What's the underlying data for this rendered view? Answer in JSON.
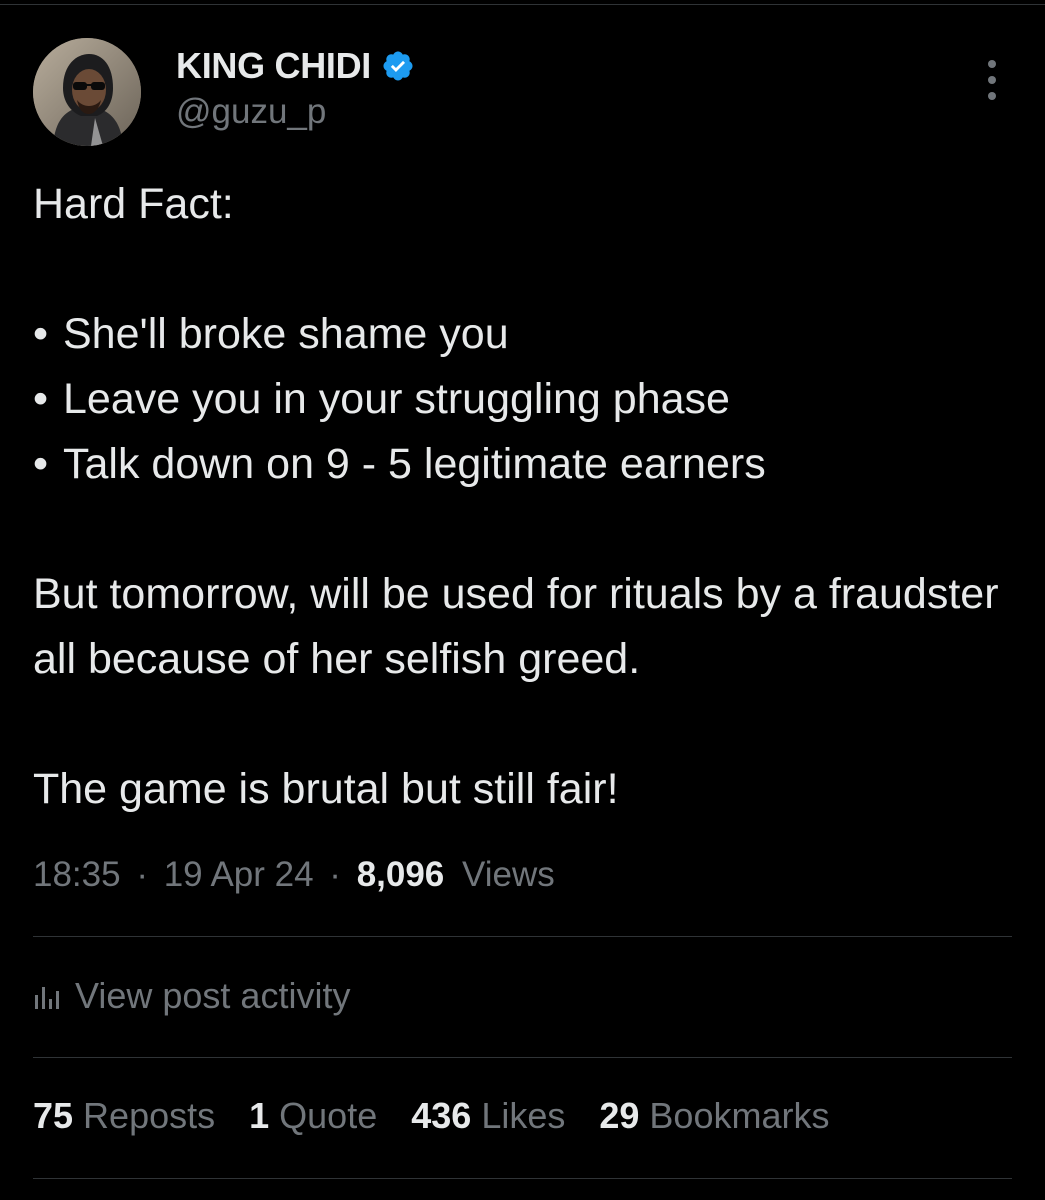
{
  "author": {
    "display_name": "KING CHIDI",
    "handle": "@guzu_p",
    "verified_icon": "verified-badge-icon",
    "accent_color": "#1d9bf0"
  },
  "tweet": {
    "line_1": "Hard Fact:",
    "bullet_char": "•",
    "bullets": [
      "She'll broke shame you",
      "Leave you in your struggling phase",
      "Talk down on 9 - 5 legitimate earners"
    ],
    "paragraph_1": "But tomorrow, will be used for rituals by a fraudster all because of her selfish greed.",
    "paragraph_2": "The game is brutal but still fair!"
  },
  "meta": {
    "time": "18:35",
    "separator": "·",
    "date": "19 Apr 24",
    "views_count": "8,096",
    "views_label": "Views"
  },
  "activity": {
    "icon": "bar-chart-icon",
    "label": "View post activity"
  },
  "stats": {
    "reposts_count": "75",
    "reposts_label": "Reposts",
    "quote_count": "1",
    "quote_label": "Quote",
    "likes_count": "436",
    "likes_label": "Likes",
    "bookmarks_count": "29",
    "bookmarks_label": "Bookmarks"
  },
  "colors": {
    "background": "#000000",
    "primary_text": "#e7e9ea",
    "secondary_text": "#71767b",
    "divider": "#2f3336"
  }
}
